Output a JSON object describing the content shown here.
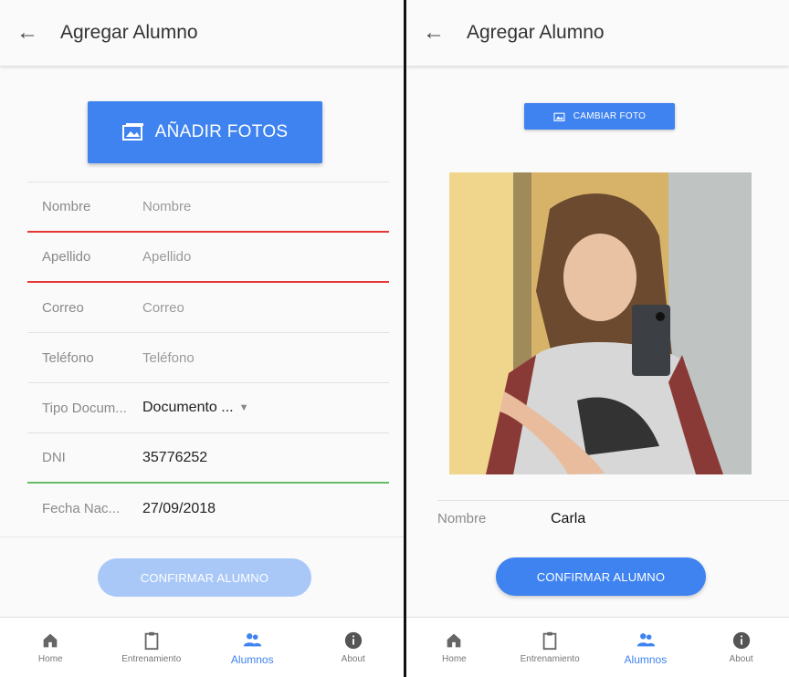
{
  "left": {
    "appbar": {
      "back": "←",
      "title": "Agregar Alumno"
    },
    "add_photos_label": "AÑADIR FOTOS",
    "fields": [
      {
        "label": "Nombre",
        "value": "Nombre"
      },
      {
        "label": "Apellido",
        "value": "Apellido"
      },
      {
        "label": "Correo",
        "value": "Correo"
      },
      {
        "label": "Teléfono",
        "value": "Teléfono"
      },
      {
        "label": "Tipo Docum...",
        "value": "Documento ..."
      },
      {
        "label": "DNI",
        "value": "35776252"
      },
      {
        "label": "Fecha Nac...",
        "value": "27/09/2018"
      }
    ],
    "confirm_label": "CONFIRMAR ALUMNO"
  },
  "right": {
    "appbar": {
      "back": "←",
      "title": "Agregar Alumno"
    },
    "change_photo_label": "CAMBIAR FOTO",
    "name_label": "Nombre",
    "name_value": "Carla",
    "confirm_label": "CONFIRMAR ALUMNO"
  },
  "bottom_nav": [
    {
      "label": "Home",
      "icon": "home-icon"
    },
    {
      "label": "Entrenamiento",
      "icon": "clipboard-icon"
    },
    {
      "label": "Alumnos",
      "icon": "people-icon",
      "active": true
    },
    {
      "label": "About",
      "icon": "info-icon"
    }
  ],
  "colors": {
    "primary": "#3f83f0",
    "primary_disabled": "#a9c8f8",
    "error_line": "#e53935",
    "success_line": "#66bb6a"
  }
}
